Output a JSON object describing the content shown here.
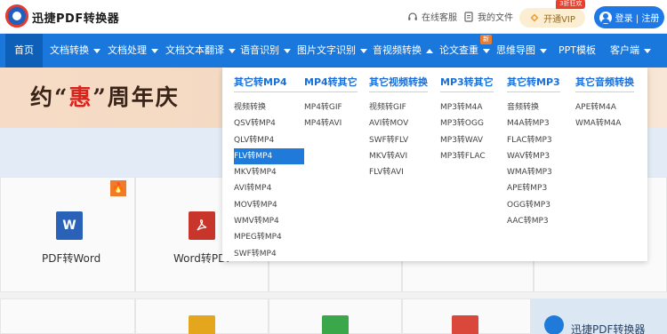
{
  "app": {
    "name": "迅捷PDF转换器"
  },
  "header": {
    "service_label": "在线客服",
    "files_label": "我的文件",
    "vip_label": "开通VIP",
    "vip_badge": "3折狂欢",
    "login_label": "登录 | 注册"
  },
  "nav": {
    "items": [
      {
        "label": "首页"
      },
      {
        "label": "文档转换"
      },
      {
        "label": "文档处理"
      },
      {
        "label": "文档文本翻译"
      },
      {
        "label": "语音识别"
      },
      {
        "label": "图片文字识别"
      },
      {
        "label": "音视频转换"
      },
      {
        "label": "论文查重"
      },
      {
        "label": "思维导图"
      },
      {
        "label": "PPT模板"
      },
      {
        "label": "客户端"
      }
    ],
    "new_badge": "新"
  },
  "banner": {
    "prefix": "约“",
    "highlight": "惠",
    "suffix": "”周年庆"
  },
  "cards": {
    "pdf_to_word": "PDF转Word",
    "word_to_pdf": "Word转PDF",
    "word_icon_letter": "W",
    "fire_mark": "🔥",
    "promo_text": "迅捷PDF转换器"
  },
  "dropdown": {
    "columns": [
      {
        "header": "其它转MP4",
        "items": [
          "视频转换",
          "QSV转MP4",
          "QLV转MP4",
          "FLV转MP4",
          "MKV转MP4",
          "AVI转MP4",
          "MOV转MP4",
          "WMV转MP4",
          "MPEG转MP4",
          "SWF转MP4"
        ]
      },
      {
        "header": "MP4转其它",
        "items": [
          "MP4转GIF",
          "MP4转AVI"
        ]
      },
      {
        "header": "其它视频转换",
        "items": [
          "视频转GIF",
          "AVI转MOV",
          "SWF转FLV",
          "MKV转AVI",
          "FLV转AVI"
        ]
      },
      {
        "header": "MP3转其它",
        "items": [
          "MP3转M4A",
          "MP3转OGG",
          "MP3转WAV",
          "MP3转FLAC"
        ]
      },
      {
        "header": "其它转MP3",
        "items": [
          "音频转换",
          "M4A转MP3",
          "FLAC转MP3",
          "WAV转MP3",
          "WMA转MP3",
          "APE转MP3",
          "OGG转MP3",
          "AAC转MP3"
        ]
      },
      {
        "header": "其它音频转换",
        "items": [
          "APE转M4A",
          "WMA转M4A"
        ]
      }
    ],
    "selected_item": "FLV转MP4"
  },
  "colors": {
    "nav_blue": "#1a78dd",
    "nav_active": "#0e5fb8",
    "accent_blue": "#1a6fd8",
    "vip_bg": "#fbeed2",
    "badge_red": "#e8402d"
  },
  "icons": {
    "logo": "brand-logo-icon",
    "service": "headset-icon",
    "files": "document-icon",
    "vip": "crown-icon",
    "login": "user-avatar-icon",
    "caret": "chevron-down-icon"
  }
}
